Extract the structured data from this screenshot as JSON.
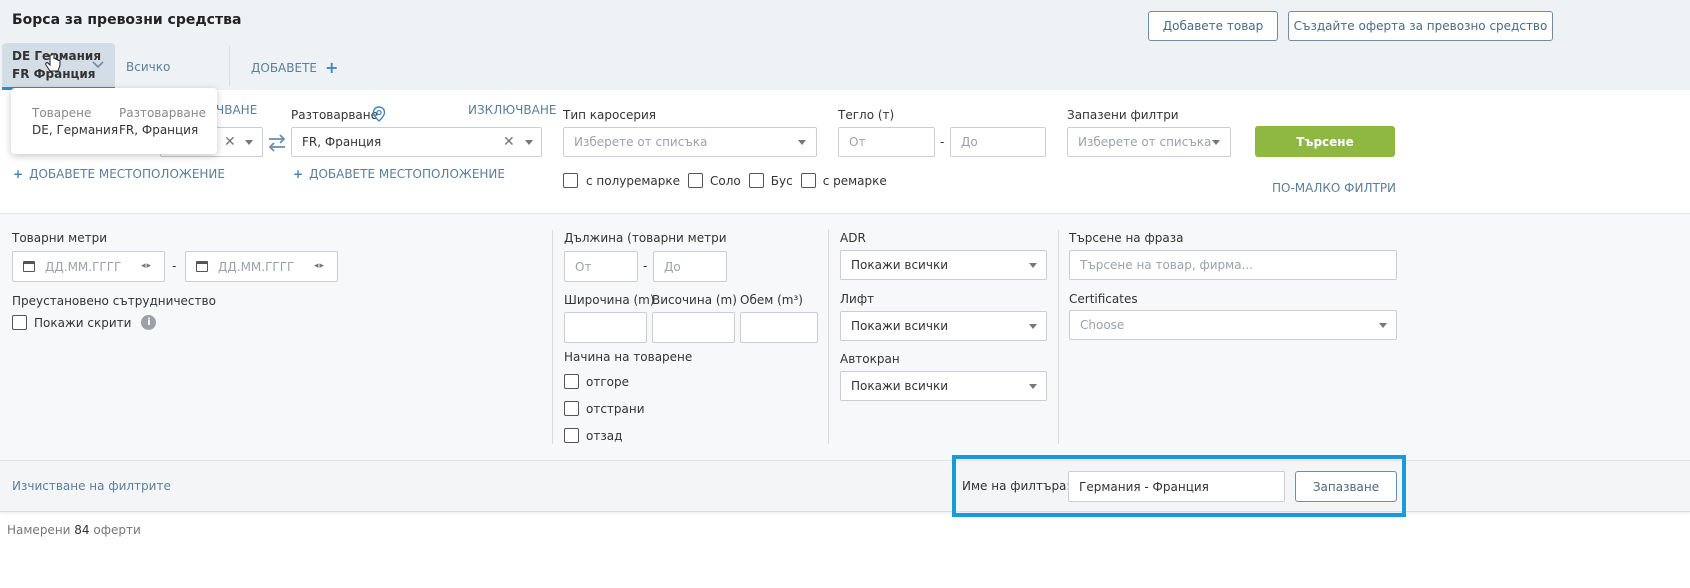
{
  "header": {
    "title": "Борса за превозни средства",
    "add_goods_label": "Добавете товар",
    "create_offer_label": "Създайте оферта за превозно средство"
  },
  "tabs": {
    "active_line1": "DE Германия",
    "active_line2": "FR Франция",
    "all_label": "Всичко",
    "add_label": "ДОБАВЕТЕ"
  },
  "popup": {
    "loading_header": "Товарене",
    "unloading_header": "Разтоварване",
    "loading_value": "DE, Германия",
    "unloading_value": "FR, Франция"
  },
  "main": {
    "exclude_left_partial": "ЧВАНЕ",
    "unloading_label": "Разтоварване",
    "exclude_label": "ИЗКЛЮЧВАНЕ",
    "unloading_value": "FR,  Франция",
    "add_location_left": "ДОБАВЕТЕ МЕСТОПОЛОЖЕНИЕ",
    "add_location_right": "ДОБАВЕТЕ МЕСТОПОЛОЖЕНИЕ",
    "body_type_label": "Тип каросерия",
    "body_type_placeholder": "Изберете от списъка",
    "weight_label": "Тегло (т)",
    "weight_from": "От",
    "weight_to": "До",
    "weight_dash": "-",
    "saved_filters_label": "Запазени филтри",
    "saved_filters_placeholder": "Изберете от списъка",
    "search_button": "Търсене",
    "fewer_filters": "ПО-МАЛКО ФИЛТРИ",
    "vehicle_types": [
      "с полуремарке",
      "Соло",
      "Бус",
      "с ремарке"
    ]
  },
  "extended": {
    "cargo_meters_label": "Товарни метри",
    "date_placeholder": "ДД.ММ.ГГГГ",
    "date_dash": "-",
    "suspended_label": "Преустановено сътрудничество",
    "show_hidden_label": "Покажи скрити",
    "length_label": "Дължина (товарни метри",
    "length_from": "От",
    "length_to": "До",
    "width_label": "Широчина (m)",
    "height_label": "Височина (m)",
    "volume_label": "Обем (m³)",
    "loading_method_label": "Начина на товарене",
    "loading_methods": [
      "отгоре",
      "отстрани",
      "отзад"
    ],
    "adr_label": "ADR",
    "adr_value": "Покажи всички",
    "lift_label": "Лифт",
    "lift_value": "Покажи всички",
    "crane_label": "Автокран",
    "crane_value": "Покажи всички",
    "phrase_label": "Търсене на фраза",
    "phrase_placeholder": "Търсене на товар, фирма...",
    "certificates_label": "Certificates",
    "certificates_placeholder": "Choose"
  },
  "footer": {
    "clear_filters": "Изчистване на филтрите",
    "filter_name_label": "Име на филтъра:",
    "filter_name_value": "Германия - Франция",
    "save_label": "Запазване"
  },
  "results": {
    "prefix": "Намерени",
    "count": "84",
    "suffix": "оферти"
  },
  "colors": {
    "accent_green": "#8fb843",
    "highlight_blue": "#1a9bd8",
    "tab_active_bg": "#d3dde6"
  }
}
